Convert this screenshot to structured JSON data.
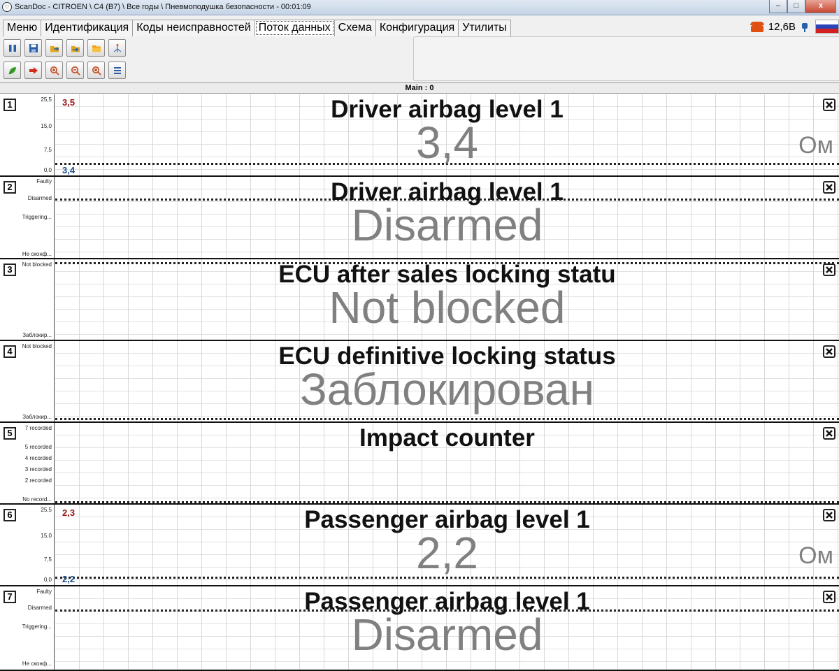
{
  "window": {
    "title": "ScanDoc - CITROEN \\ C4 (B7) \\ Все годы \\ Пневмоподушка безопасности - 00:01:09",
    "min_glyph": "–",
    "max_glyph": "□",
    "close_glyph": "x"
  },
  "tabs": [
    {
      "label": "Меню"
    },
    {
      "label": "Идентификация"
    },
    {
      "label": "Коды неисправностей"
    },
    {
      "label": "Поток данных",
      "active": true
    },
    {
      "label": "Схема"
    },
    {
      "label": "Конфигурация"
    },
    {
      "label": "Утилиты"
    }
  ],
  "status": {
    "voltage": "12,6В"
  },
  "colors": {
    "accent_max": "#9b1515",
    "accent_min": "#1d4e92",
    "value_gray": "#808080"
  },
  "main": {
    "label": "Main : 0"
  },
  "channels": [
    {
      "num": "1",
      "title": "Driver airbag level 1",
      "value": "3,4",
      "unit": "Ом",
      "max": "3,5",
      "min": "3,4",
      "ticks": [
        "25,5",
        "15,0",
        "7,5",
        "0,0"
      ]
    },
    {
      "num": "2",
      "title": "Driver airbag level 1",
      "value": "Disarmed",
      "ticks": [
        "Faulty",
        "Disarmed",
        "Triggering...",
        "Не сконф..."
      ]
    },
    {
      "num": "3",
      "title": "ECU after sales locking statu",
      "value": "Not blocked",
      "ticks": [
        "Not blocked",
        "Заблокир..."
      ]
    },
    {
      "num": "4",
      "title": "ECU definitive locking status",
      "value": "Заблокирован",
      "ticks": [
        "Not blocked",
        "Заблокир..."
      ]
    },
    {
      "num": "5",
      "title": "Impact counter",
      "value": "",
      "ticks": [
        "7 recorded",
        "5 recorded",
        "4 recorded",
        "3 recorded",
        "2 recorded",
        "No record..."
      ]
    },
    {
      "num": "6",
      "title": "Passenger airbag level 1",
      "value": "2,2",
      "unit": "Ом",
      "max": "2,3",
      "min": "2,2",
      "ticks": [
        "25,5",
        "15,0",
        "7,5",
        "0,0"
      ]
    },
    {
      "num": "7",
      "title": "Passenger airbag level 1",
      "value": "Disarmed",
      "ticks": [
        "Faulty",
        "Disarmed",
        "Triggering...",
        "Не сконф..."
      ]
    }
  ]
}
